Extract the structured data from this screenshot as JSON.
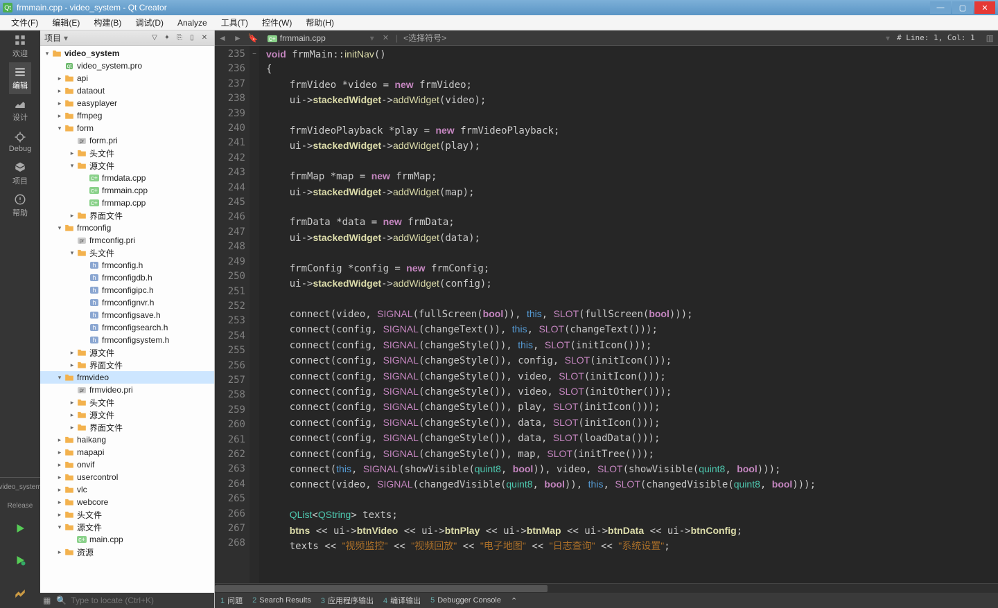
{
  "title": "frmmain.cpp - video_system - Qt Creator",
  "menu": [
    "文件(F)",
    "编辑(E)",
    "构建(B)",
    "调试(D)",
    "Analyze",
    "工具(T)",
    "控件(W)",
    "帮助(H)"
  ],
  "iconbar": {
    "items": [
      "欢迎",
      "编辑",
      "设计",
      "Debug",
      "项目",
      "帮助"
    ],
    "active": 1,
    "projectLabel": "video_system",
    "releaseLabel": "Release"
  },
  "projectPanel": {
    "title": "项目"
  },
  "tree": [
    {
      "d": 0,
      "a": "▾",
      "i": "folder",
      "t": "video_system",
      "bold": true
    },
    {
      "d": 1,
      "a": "",
      "i": "file-pro",
      "t": "video_system.pro"
    },
    {
      "d": 1,
      "a": "▸",
      "i": "folder",
      "t": "api"
    },
    {
      "d": 1,
      "a": "▸",
      "i": "folder",
      "t": "dataout"
    },
    {
      "d": 1,
      "a": "▸",
      "i": "folder",
      "t": "easyplayer"
    },
    {
      "d": 1,
      "a": "▸",
      "i": "folder",
      "t": "ffmpeg"
    },
    {
      "d": 1,
      "a": "▾",
      "i": "folder",
      "t": "form"
    },
    {
      "d": 2,
      "a": "",
      "i": "file-pri",
      "t": "form.pri"
    },
    {
      "d": 2,
      "a": "▸",
      "i": "folder",
      "t": "头文件"
    },
    {
      "d": 2,
      "a": "▾",
      "i": "folder",
      "t": "源文件"
    },
    {
      "d": 3,
      "a": "",
      "i": "file-cpp",
      "t": "frmdata.cpp"
    },
    {
      "d": 3,
      "a": "",
      "i": "file-cpp",
      "t": "frmmain.cpp"
    },
    {
      "d": 3,
      "a": "",
      "i": "file-cpp",
      "t": "frmmap.cpp"
    },
    {
      "d": 2,
      "a": "▸",
      "i": "folder",
      "t": "界面文件"
    },
    {
      "d": 1,
      "a": "▾",
      "i": "folder",
      "t": "frmconfig"
    },
    {
      "d": 2,
      "a": "",
      "i": "file-pri",
      "t": "frmconfig.pri"
    },
    {
      "d": 2,
      "a": "▾",
      "i": "folder",
      "t": "头文件"
    },
    {
      "d": 3,
      "a": "",
      "i": "file-h",
      "t": "frmconfig.h"
    },
    {
      "d": 3,
      "a": "",
      "i": "file-h",
      "t": "frmconfigdb.h"
    },
    {
      "d": 3,
      "a": "",
      "i": "file-h",
      "t": "frmconfigipc.h"
    },
    {
      "d": 3,
      "a": "",
      "i": "file-h",
      "t": "frmconfignvr.h"
    },
    {
      "d": 3,
      "a": "",
      "i": "file-h",
      "t": "frmconfigsave.h"
    },
    {
      "d": 3,
      "a": "",
      "i": "file-h",
      "t": "frmconfigsearch.h"
    },
    {
      "d": 3,
      "a": "",
      "i": "file-h",
      "t": "frmconfigsystem.h"
    },
    {
      "d": 2,
      "a": "▸",
      "i": "folder",
      "t": "源文件"
    },
    {
      "d": 2,
      "a": "▸",
      "i": "folder",
      "t": "界面文件"
    },
    {
      "d": 1,
      "a": "▾",
      "i": "folder",
      "t": "frmvideo",
      "sel": true
    },
    {
      "d": 2,
      "a": "",
      "i": "file-pri",
      "t": "frmvideo.pri"
    },
    {
      "d": 2,
      "a": "▸",
      "i": "folder",
      "t": "头文件"
    },
    {
      "d": 2,
      "a": "▸",
      "i": "folder",
      "t": "源文件"
    },
    {
      "d": 2,
      "a": "▸",
      "i": "folder",
      "t": "界面文件"
    },
    {
      "d": 1,
      "a": "▸",
      "i": "folder",
      "t": "haikang"
    },
    {
      "d": 1,
      "a": "▸",
      "i": "folder",
      "t": "mapapi"
    },
    {
      "d": 1,
      "a": "▸",
      "i": "folder",
      "t": "onvif"
    },
    {
      "d": 1,
      "a": "▸",
      "i": "folder",
      "t": "usercontrol"
    },
    {
      "d": 1,
      "a": "▸",
      "i": "folder",
      "t": "vlc"
    },
    {
      "d": 1,
      "a": "▸",
      "i": "folder",
      "t": "webcore"
    },
    {
      "d": 1,
      "a": "▸",
      "i": "folder",
      "t": "头文件"
    },
    {
      "d": 1,
      "a": "▾",
      "i": "folder",
      "t": "源文件"
    },
    {
      "d": 2,
      "a": "",
      "i": "file-cpp",
      "t": "main.cpp"
    },
    {
      "d": 1,
      "a": "▸",
      "i": "folder",
      "t": "资源"
    }
  ],
  "locator": {
    "placeholder": "Type to locate (Ctrl+K)"
  },
  "editor": {
    "tabName": "frmmain.cpp",
    "symbolSelector": "<选择符号>",
    "lineInfo": "# Line: 1, Col: 1",
    "startLine": 235,
    "lineCount": 34
  },
  "code": {
    "strings": {
      "s1": "\"视频监控\"",
      "s2": "\"视频回放\"",
      "s3": "\"电子地图\"",
      "s4": "\"日志查询\"",
      "s5": "\"系统设置\""
    }
  },
  "status": {
    "items": [
      {
        "n": "1",
        "t": "问题"
      },
      {
        "n": "2",
        "t": "Search Results"
      },
      {
        "n": "3",
        "t": "应用程序输出"
      },
      {
        "n": "4",
        "t": "编译输出"
      },
      {
        "n": "5",
        "t": "Debugger Console"
      }
    ]
  }
}
